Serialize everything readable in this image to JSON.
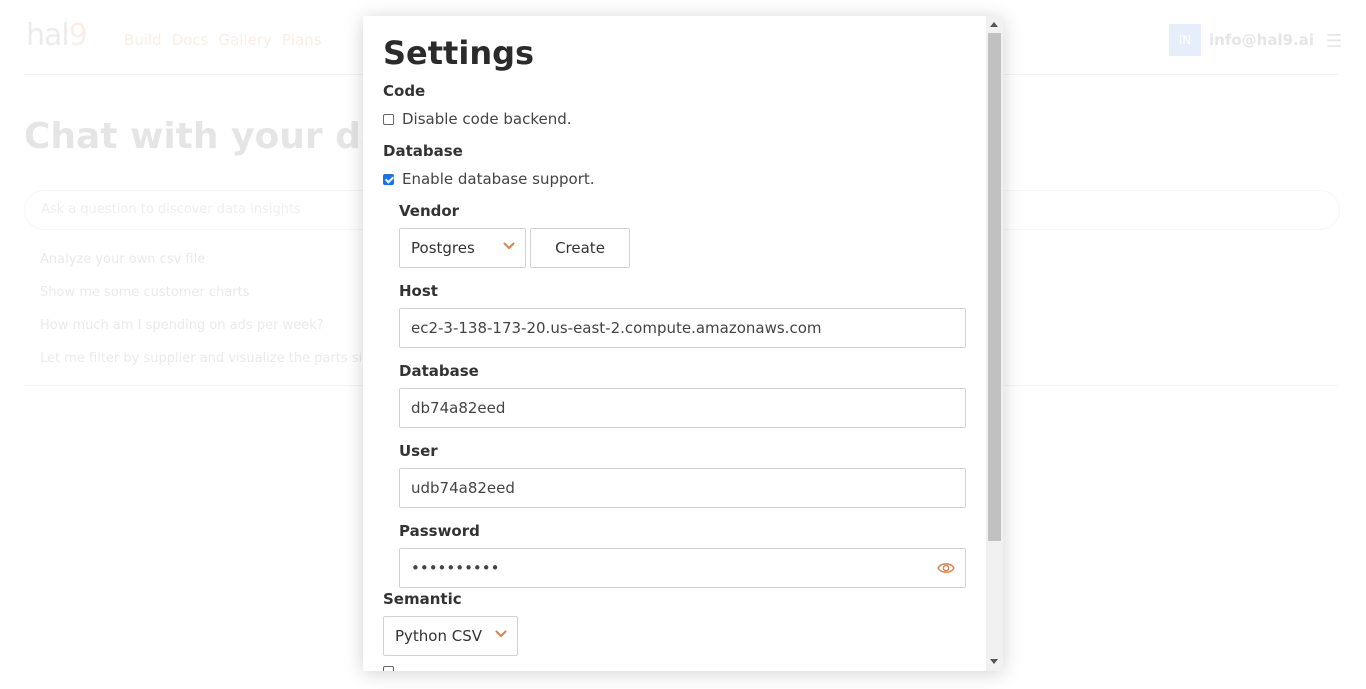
{
  "background": {
    "logo_text": "hal",
    "logo_digit": "9",
    "nav": [
      "Build",
      "Docs",
      "Gallery",
      "Plans"
    ],
    "avatar_initials": "IN",
    "user_email": "info@hal9.ai",
    "headline": "Chat with your data",
    "prompt_placeholder": "Ask a question to discover data insights",
    "suggestions": [
      "Analyze your own csv file",
      "Show me some customer charts",
      "How much am I spending on ads per week?",
      "Let me filter by supplier and visualize the parts sizes"
    ]
  },
  "modal": {
    "title": "Settings",
    "code": {
      "section": "Code",
      "disable_label": "Disable code backend.",
      "disable_checked": false
    },
    "database": {
      "section": "Database",
      "enable_label": "Enable database support.",
      "enable_checked": true,
      "vendor_label": "Vendor",
      "vendor_value": "Postgres",
      "create_label": "Create",
      "host_label": "Host",
      "host_value": "ec2-3-138-173-20.us-east-2.compute.amazonaws.com",
      "database_label": "Database",
      "database_value": "db74a82eed",
      "user_label": "User",
      "user_value": "udb74a82eed",
      "password_label": "Password",
      "password_value": "••••••••••"
    },
    "semantic": {
      "section": "Semantic",
      "select_value": "Python CSV"
    }
  },
  "colors": {
    "accent": "#d9824c",
    "checkbox": "#1a73e8"
  }
}
